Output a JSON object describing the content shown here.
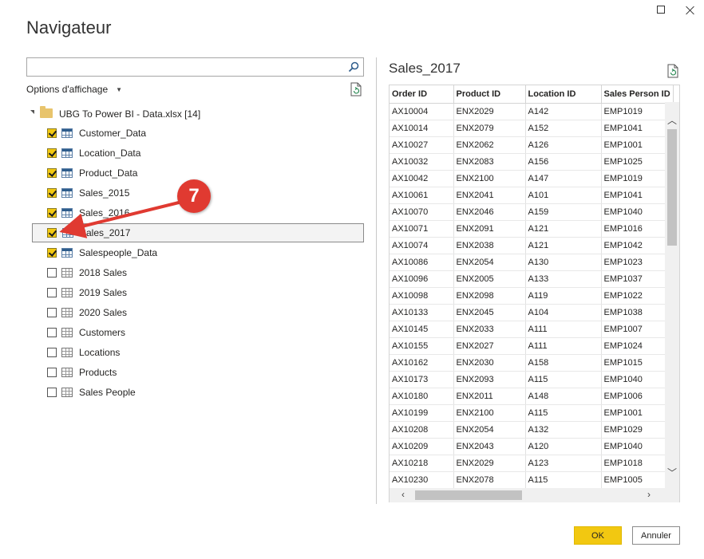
{
  "dialog": {
    "title": "Navigateur"
  },
  "search": {
    "value": "",
    "placeholder": ""
  },
  "display_options": {
    "label": "Options d'affichage"
  },
  "tree": {
    "root_label": "UBG To Power BI - Data.xlsx [14]",
    "items": [
      {
        "label": "Customer_Data",
        "checked": true,
        "kind": "table"
      },
      {
        "label": "Location_Data",
        "checked": true,
        "kind": "table"
      },
      {
        "label": "Product_Data",
        "checked": true,
        "kind": "table"
      },
      {
        "label": "Sales_2015",
        "checked": true,
        "kind": "table"
      },
      {
        "label": "Sales_2016",
        "checked": true,
        "kind": "table"
      },
      {
        "label": "Sales_2017",
        "checked": true,
        "kind": "table",
        "selected": true
      },
      {
        "label": "Salespeople_Data",
        "checked": true,
        "kind": "table"
      },
      {
        "label": "2018 Sales",
        "checked": false,
        "kind": "sheet"
      },
      {
        "label": "2019 Sales",
        "checked": false,
        "kind": "sheet"
      },
      {
        "label": "2020 Sales",
        "checked": false,
        "kind": "sheet"
      },
      {
        "label": "Customers",
        "checked": false,
        "kind": "sheet"
      },
      {
        "label": "Locations",
        "checked": false,
        "kind": "sheet"
      },
      {
        "label": "Products",
        "checked": false,
        "kind": "sheet"
      },
      {
        "label": "Sales People",
        "checked": false,
        "kind": "sheet"
      }
    ]
  },
  "preview": {
    "title": "Sales_2017",
    "columns": [
      "Order ID",
      "Product ID",
      "Location ID",
      "Sales Person ID"
    ],
    "rows": [
      [
        "AX10004",
        "ENX2029",
        "A142",
        "EMP1019"
      ],
      [
        "AX10014",
        "ENX2079",
        "A152",
        "EMP1041"
      ],
      [
        "AX10027",
        "ENX2062",
        "A126",
        "EMP1001"
      ],
      [
        "AX10032",
        "ENX2083",
        "A156",
        "EMP1025"
      ],
      [
        "AX10042",
        "ENX2100",
        "A147",
        "EMP1019"
      ],
      [
        "AX10061",
        "ENX2041",
        "A101",
        "EMP1041"
      ],
      [
        "AX10070",
        "ENX2046",
        "A159",
        "EMP1040"
      ],
      [
        "AX10071",
        "ENX2091",
        "A121",
        "EMP1016"
      ],
      [
        "AX10074",
        "ENX2038",
        "A121",
        "EMP1042"
      ],
      [
        "AX10086",
        "ENX2054",
        "A130",
        "EMP1023"
      ],
      [
        "AX10096",
        "ENX2005",
        "A133",
        "EMP1037"
      ],
      [
        "AX10098",
        "ENX2098",
        "A119",
        "EMP1022"
      ],
      [
        "AX10133",
        "ENX2045",
        "A104",
        "EMP1038"
      ],
      [
        "AX10145",
        "ENX2033",
        "A111",
        "EMP1007"
      ],
      [
        "AX10155",
        "ENX2027",
        "A111",
        "EMP1024"
      ],
      [
        "AX10162",
        "ENX2030",
        "A158",
        "EMP1015"
      ],
      [
        "AX10173",
        "ENX2093",
        "A115",
        "EMP1040"
      ],
      [
        "AX10180",
        "ENX2011",
        "A148",
        "EMP1006"
      ],
      [
        "AX10199",
        "ENX2100",
        "A115",
        "EMP1001"
      ],
      [
        "AX10208",
        "ENX2054",
        "A132",
        "EMP1029"
      ],
      [
        "AX10209",
        "ENX2043",
        "A120",
        "EMP1040"
      ],
      [
        "AX10218",
        "ENX2029",
        "A123",
        "EMP1018"
      ],
      [
        "AX10230",
        "ENX2078",
        "A115",
        "EMP1005"
      ]
    ]
  },
  "buttons": {
    "ok": "OK",
    "cancel": "Annuler"
  },
  "annotation": {
    "step": "7",
    "color": "#e03a31"
  },
  "colors": {
    "accent": "#f2c811"
  }
}
